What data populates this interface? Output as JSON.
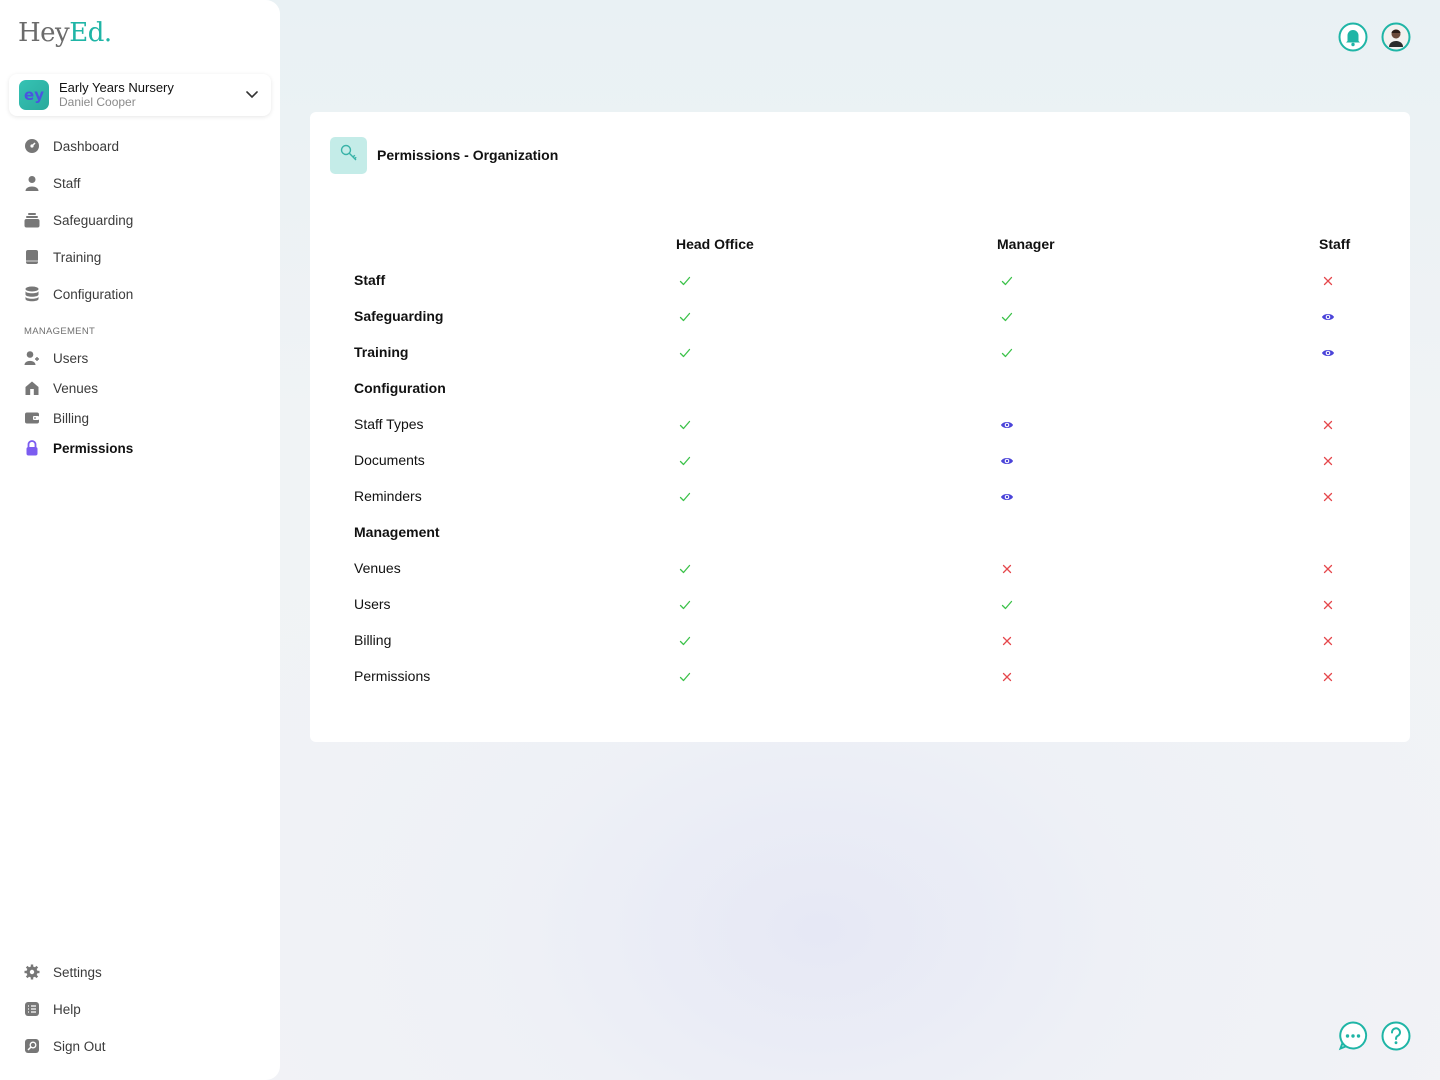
{
  "app": {
    "logo_part1": "Hey",
    "logo_part2": "Ed."
  },
  "org": {
    "name": "Early Years Nursery",
    "user": "Daniel Cooper",
    "avatar_letters": "ey"
  },
  "nav": {
    "main": [
      {
        "label": "Dashboard",
        "icon": "dashboard-icon"
      },
      {
        "label": "Staff",
        "icon": "person-icon"
      },
      {
        "label": "Safeguarding",
        "icon": "stack-icon"
      },
      {
        "label": "Training",
        "icon": "book-icon"
      },
      {
        "label": "Configuration",
        "icon": "database-icon"
      }
    ],
    "management_label": "MANAGEMENT",
    "management": [
      {
        "label": "Users",
        "icon": "add-user-icon"
      },
      {
        "label": "Venues",
        "icon": "home-icon"
      },
      {
        "label": "Billing",
        "icon": "wallet-icon"
      },
      {
        "label": "Permissions",
        "icon": "lock-icon",
        "active": true
      }
    ],
    "bottom": [
      {
        "label": "Settings",
        "icon": "gear-icon"
      },
      {
        "label": "Help",
        "icon": "list-icon"
      },
      {
        "label": "Sign Out",
        "icon": "sign-out-icon"
      }
    ]
  },
  "card": {
    "title": "Permissions - Organization",
    "icon": "key-icon"
  },
  "permissions": {
    "columns": [
      "Head Office",
      "Manager",
      "Staff"
    ],
    "rows": [
      {
        "label": "Staff",
        "bold": true,
        "values": [
          "check",
          "check",
          "cross"
        ]
      },
      {
        "label": "Safeguarding",
        "bold": true,
        "values": [
          "check",
          "check",
          "view"
        ]
      },
      {
        "label": "Training",
        "bold": true,
        "values": [
          "check",
          "check",
          "view"
        ]
      },
      {
        "label": "Configuration",
        "bold": true,
        "values": []
      },
      {
        "label": "Staff Types",
        "bold": false,
        "values": [
          "check",
          "view",
          "cross"
        ]
      },
      {
        "label": "Documents",
        "bold": false,
        "values": [
          "check",
          "view",
          "cross"
        ]
      },
      {
        "label": "Reminders",
        "bold": false,
        "values": [
          "check",
          "view",
          "cross"
        ]
      },
      {
        "label": "Management",
        "bold": true,
        "values": []
      },
      {
        "label": "Venues",
        "bold": false,
        "values": [
          "check",
          "cross",
          "cross"
        ]
      },
      {
        "label": "Users",
        "bold": false,
        "values": [
          "check",
          "check",
          "cross"
        ]
      },
      {
        "label": "Billing",
        "bold": false,
        "values": [
          "check",
          "cross",
          "cross"
        ]
      },
      {
        "label": "Permissions",
        "bold": false,
        "values": [
          "check",
          "cross",
          "cross"
        ]
      }
    ]
  },
  "colors": {
    "accent": "#1fb5a6",
    "check": "#3cc24a",
    "cross": "#e5484d",
    "view": "#4b44d9",
    "active_nav_icon": "#7b5cf0"
  }
}
